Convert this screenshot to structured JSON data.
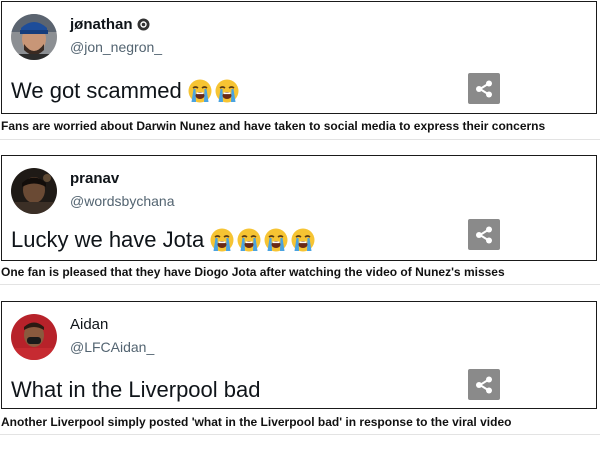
{
  "posts": [
    {
      "name": "jønathan",
      "handle": "@jon_negron_",
      "text": "We got scammed",
      "emoji_count": 2,
      "emoji": "loudly-crying-face",
      "verified": true,
      "caption": "Fans are worried about Darwin Nunez and have taken to social media to express their concerns"
    },
    {
      "name": "pranav",
      "handle": "@wordsbychana",
      "text": "Lucky we have Jota",
      "emoji_count": 4,
      "emoji": "loudly-crying-face",
      "verified": false,
      "caption": "One fan is pleased that they have Diogo Jota after watching the video of Nunez's misses"
    },
    {
      "name": "Aidan",
      "handle": "@LFCAidan_",
      "text": "What in the Liverpool bad",
      "emoji_count": 0,
      "emoji": "",
      "verified": false,
      "caption": "Another Liverpool simply posted 'what in the Liverpool bad' in response to the viral video"
    }
  ],
  "icons": {
    "share": "share-icon",
    "verified": "verified-badge-icon"
  },
  "colors": {
    "share_button": "#8a8a8a",
    "border": "#1a1a1a",
    "handle": "#536471",
    "emoji_face": "#f6c433",
    "emoji_tears": "#4aa3e0"
  }
}
